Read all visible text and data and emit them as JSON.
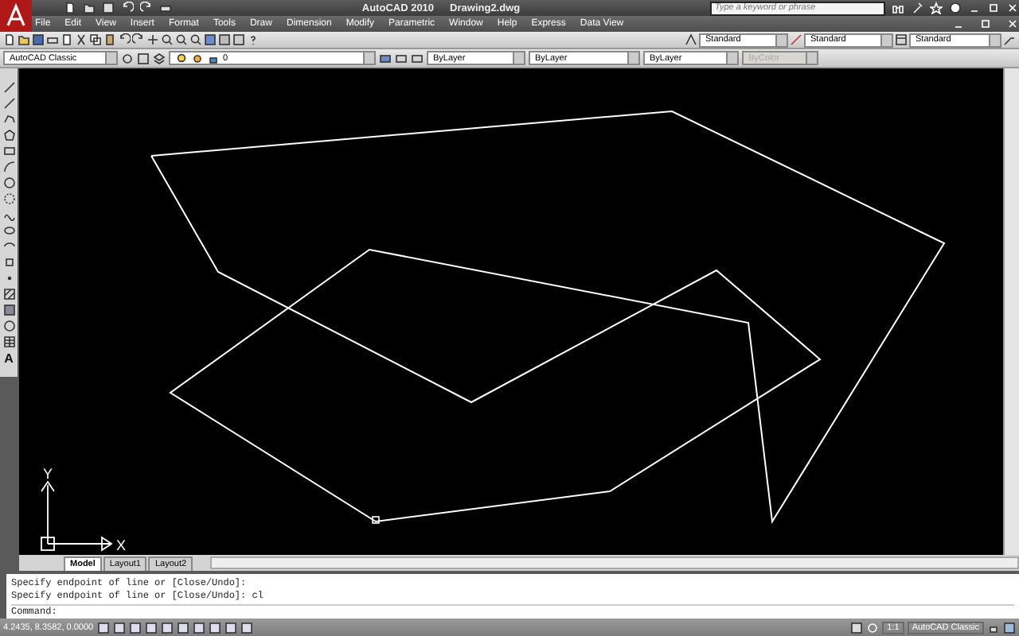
{
  "window": {
    "title": "AutoCAD 2010",
    "document": "Drawing2.dwg",
    "search": {
      "placeholder": "Type a keyword or phrase"
    }
  },
  "menu": [
    "File",
    "Edit",
    "View",
    "Insert",
    "Format",
    "Tools",
    "Draw",
    "Dimension",
    "Modify",
    "Parametric",
    "Window",
    "Help",
    "Express",
    "Data View"
  ],
  "styles_toolbar": {
    "text_style": "Standard",
    "dim_style": "Standard",
    "table_style": "Standard"
  },
  "properties_toolbar": {
    "workspace": "AutoCAD Classic",
    "layer": "0",
    "color_control": "ByLayer",
    "linetype": "ByLayer",
    "lineweight": "ByLayer",
    "plot_style": {
      "value": "ByColor",
      "disabled": true
    }
  },
  "draw_toolbar": {
    "text_tool": "A"
  },
  "ucs": {
    "x_label": "X",
    "y_label": "Y"
  },
  "layout_tabs": [
    {
      "label": "Model",
      "selected": true
    },
    {
      "label": "Layout1",
      "selected": false
    },
    {
      "label": "Layout2",
      "selected": false
    }
  ],
  "command_history": [
    "Specify endpoint of line or [Close/Undo]:",
    "Specify endpoint of line or [Close/Undo]: cl"
  ],
  "command_prompt": "Command:",
  "status_bar": {
    "coordinates": "4.2435, 8.3582, 0.0000",
    "annotation_scale": "1:1",
    "workspace": "AutoCAD Classic"
  }
}
